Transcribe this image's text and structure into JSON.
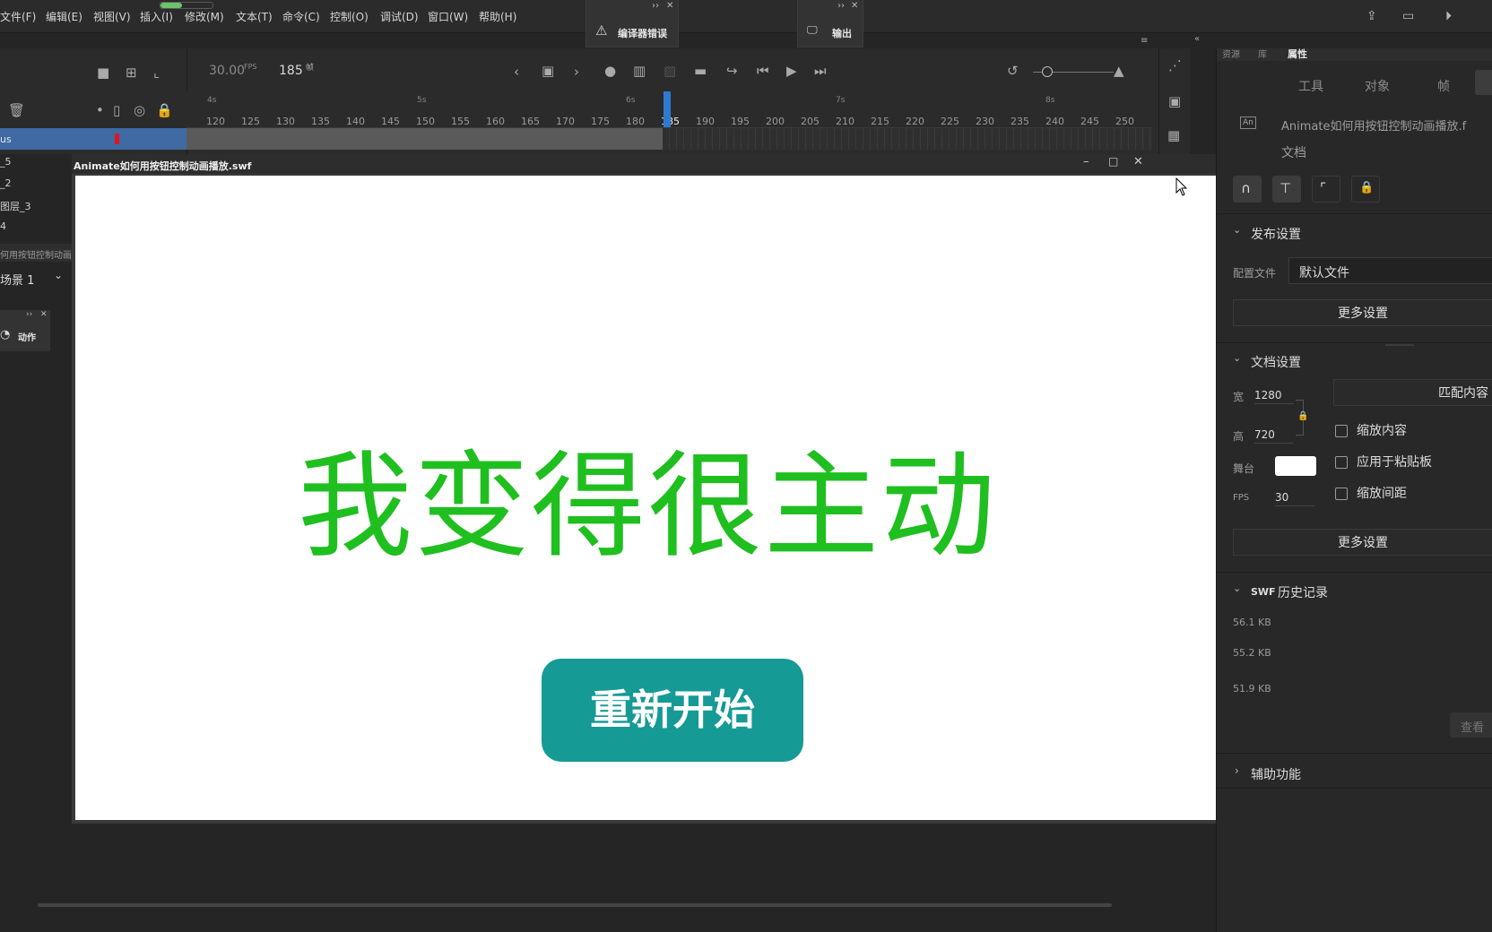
{
  "menu": [
    "文件(F)",
    "编辑(E)",
    "视图(V)",
    "插入(I)",
    "修改(M)",
    "文本(T)",
    "命令(C)",
    "控制(O)",
    "调试(D)",
    "窗口(W)",
    "帮助(H)"
  ],
  "panels": {
    "compiler_errors": "编译器错误",
    "output": "输出"
  },
  "timeline": {
    "fps": "30.00",
    "fps_unit": "FPS",
    "frame": "185",
    "frame_unit": "帧",
    "seconds": [
      "4s",
      "5s",
      "6s",
      "7s",
      "8s"
    ],
    "ruler": [
      "120",
      "125",
      "130",
      "135",
      "140",
      "145",
      "150",
      "155",
      "160",
      "165",
      "170",
      "175",
      "180",
      "185",
      "190",
      "195",
      "200",
      "205",
      "210",
      "215",
      "220",
      "225",
      "230",
      "235",
      "240",
      "245",
      "250"
    ]
  },
  "layers": [
    "us",
    "_5",
    "_2",
    "图层_3",
    "4"
  ],
  "left_panel": {
    "doc_name": "何用按钮控制动画",
    "scene": "场景 1",
    "actions": "动作"
  },
  "swf": {
    "title": "Animate如何用按钮控制动画播放.swf",
    "headline": "我变得很主动",
    "button": "重新开始",
    "headline_color": "#1fbf1f",
    "button_color": "#159a96"
  },
  "props": {
    "top_tabs": [
      "资源",
      "库",
      "属性"
    ],
    "tabs": [
      "工具",
      "对象",
      "帧"
    ],
    "doc_title": "Animate如何用按钮控制动画播放.f",
    "doc_label": "文档",
    "publish": {
      "title": "发布设置",
      "profile_label": "配置文件",
      "profile_value": "默认文件",
      "more": "更多设置"
    },
    "doc_settings": {
      "title": "文档设置",
      "width_label": "宽",
      "width": "1280",
      "height_label": "高",
      "height": "720",
      "match": "匹配内容",
      "scale_content": "缩放内容",
      "apply_paste": "应用于粘贴板",
      "scale_spacing": "缩放间距",
      "stage_label": "舞台",
      "fps_label": "FPS",
      "fps": "30",
      "more": "更多设置"
    },
    "swf_history": {
      "title_prefix": "SWF",
      "title": "历史记录",
      "items": [
        "56.1 KB",
        "55.2 KB",
        "51.9 KB"
      ],
      "view": "查看"
    },
    "accessibility": "辅助功能"
  }
}
